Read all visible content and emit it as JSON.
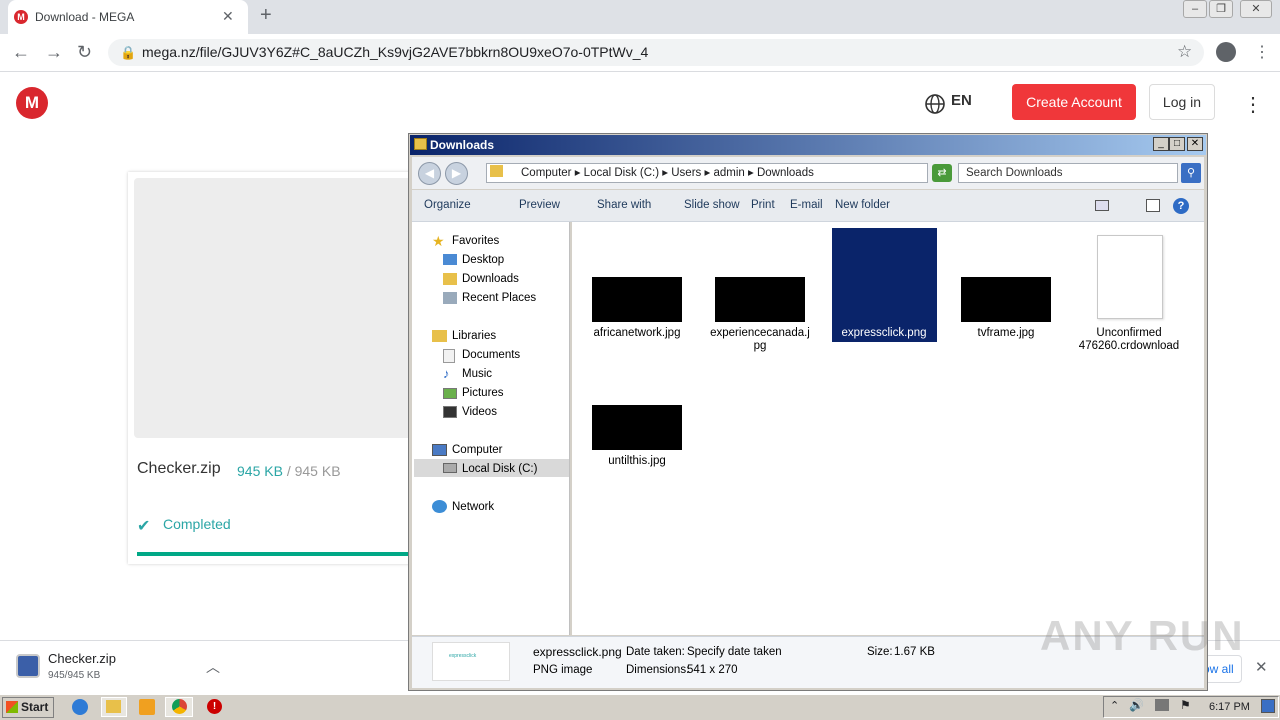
{
  "browser": {
    "tab_title": "Download - MEGA",
    "url": "mega.nz/file/GJUV3Y6Z#C_8aUCZh_Ks9vjG2AVE7bbkrn8OU9xeO7o-0TPtWv_4"
  },
  "mega": {
    "logo": "M",
    "lang": "EN",
    "create_account": "Create Account",
    "login": "Log in",
    "file_name": "Checker.zip",
    "downloaded": "945 KB",
    "total": "/ 945 KB",
    "status": "Completed",
    "progress": 1.0
  },
  "download_bar": {
    "file": "Checker.zip",
    "size": "945/945 KB",
    "show_all": "Show all"
  },
  "explorer": {
    "title": "Downloads",
    "breadcrumb": [
      "Computer",
      "Local Disk (C:)",
      "Users",
      "admin",
      "Downloads"
    ],
    "search_placeholder": "Search Downloads",
    "toolbar": [
      "Organize",
      "Preview",
      "Share with",
      "Slide show",
      "Print",
      "E-mail",
      "New folder"
    ],
    "nav": {
      "favorites": "Favorites",
      "fav_items": [
        "Desktop",
        "Downloads",
        "Recent Places"
      ],
      "libraries": "Libraries",
      "lib_items": [
        "Documents",
        "Music",
        "Pictures",
        "Videos"
      ],
      "computer": "Computer",
      "local_disk": "Local Disk (C:)",
      "network": "Network"
    },
    "files": [
      {
        "name": "africanetwork.jpg"
      },
      {
        "name": "experiencecanada.jpg",
        "line1": "experiencecanada.j",
        "line2": "pg"
      },
      {
        "name": "expressclick.png",
        "selected": true
      },
      {
        "name": "tvframe.jpg"
      },
      {
        "name": "Unconfirmed 476260.crdownload",
        "line1": "Unconfirmed",
        "line2": "476260.crdownload"
      },
      {
        "name": "untilthis.jpg"
      }
    ],
    "details": {
      "name": "expressclick.png",
      "type": "PNG image",
      "date_label": "Date taken:",
      "date_value": "Specify date taken",
      "dim_label": "Dimensions:",
      "dim_value": "541 x 270",
      "size_label": "Size:",
      "size_value": "1.67 KB",
      "thumb_text": "expressclick"
    }
  },
  "taskbar": {
    "start": "Start",
    "time": "6:17 PM"
  },
  "watermark": "ANY RUN"
}
